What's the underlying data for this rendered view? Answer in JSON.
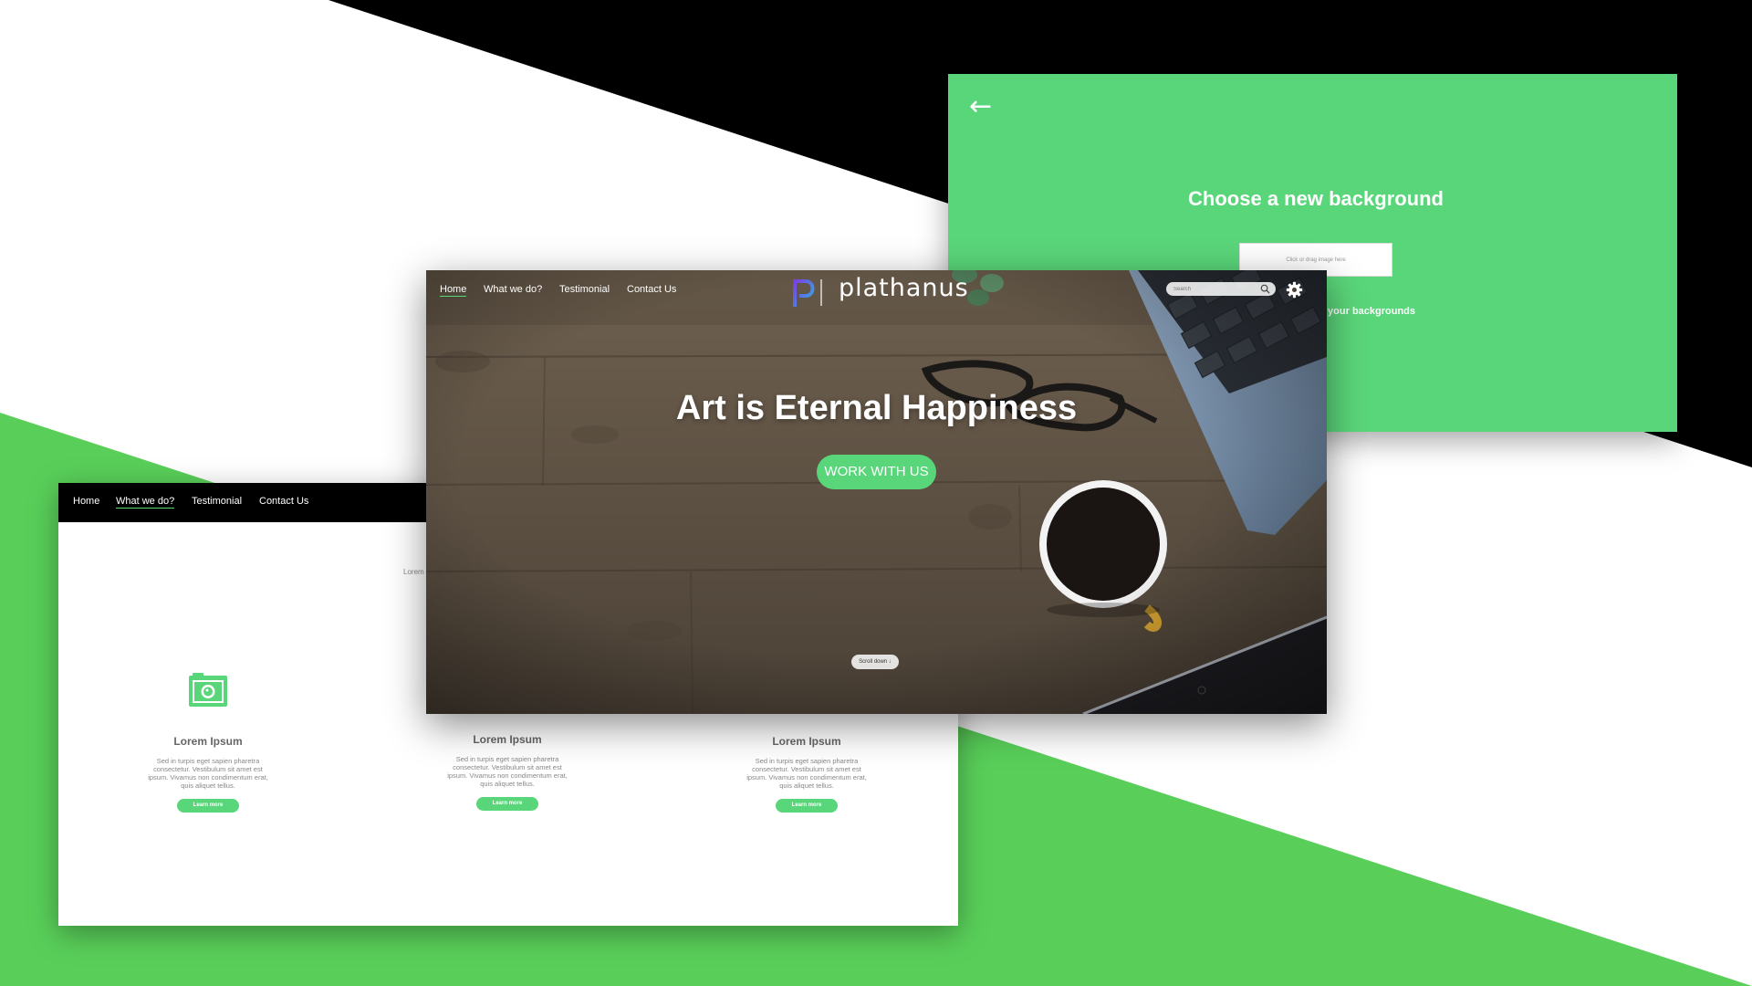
{
  "colors": {
    "accent": "#5ad67a",
    "black": "#000000",
    "white": "#ffffff",
    "muted_text": "#888888"
  },
  "settings_panel": {
    "back_icon": "arrow-left-icon",
    "title": "Choose a new background",
    "dropzone_text": "Click or drag image here",
    "partial_link": "w of your backgrounds"
  },
  "hero_page": {
    "nav": [
      {
        "label": "Home",
        "active": true
      },
      {
        "label": "What we do?",
        "active": false
      },
      {
        "label": "Testimonial",
        "active": false
      },
      {
        "label": "Contact Us",
        "active": false
      }
    ],
    "brand": {
      "name": "plathanus",
      "logo_icon": "plathanus-logo-icon"
    },
    "search": {
      "placeholder": "Search",
      "icon": "search-icon"
    },
    "settings_icon": "gear-icon",
    "headline": "Art is Eternal Happiness",
    "cta_label": "WORK WITH US",
    "scroll_hint": "Scroll down ↓"
  },
  "services_page": {
    "nav": [
      {
        "label": "Home",
        "active": false
      },
      {
        "label": "What we do?",
        "active": true
      },
      {
        "label": "Testimonial",
        "active": false
      },
      {
        "label": "Contact Us",
        "active": false
      }
    ],
    "stray_text": "Lorem",
    "feature_icon": "camera-icon",
    "features": [
      {
        "title": "Lorem Ipsum",
        "description": "Sed in turpis eget sapien pharetra consectetur. Vestibulum sit amet est ipsum. Vivamus non condimentum erat, quis aliquet tellus.",
        "button_label": "Learn more"
      },
      {
        "title": "Lorem Ipsum",
        "description": "Sed in turpis eget sapien pharetra consectetur. Vestibulum sit amet est ipsum. Vivamus non condimentum erat, quis aliquet tellus.",
        "button_label": "Learn more"
      },
      {
        "title": "Lorem Ipsum",
        "description": "Sed in turpis eget sapien pharetra consectetur. Vestibulum sit amet est ipsum. Vivamus non condimentum erat, quis aliquet tellus.",
        "button_label": "Learn more"
      }
    ]
  }
}
